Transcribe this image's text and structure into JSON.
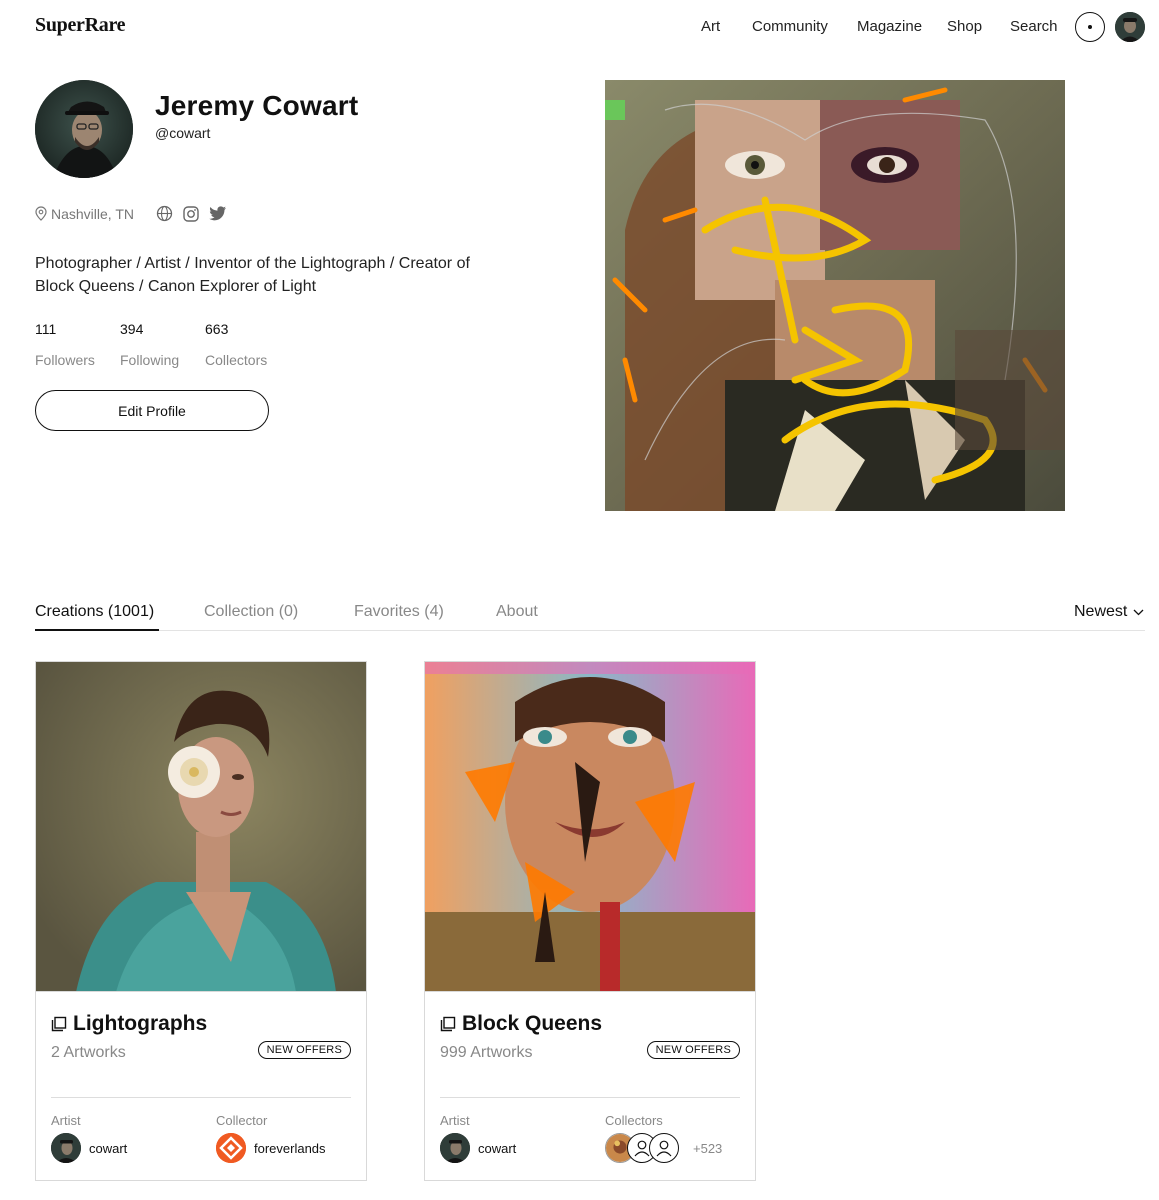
{
  "header": {
    "logo": "SuperRare",
    "nav": [
      "Art",
      "Community",
      "Magazine",
      "Shop",
      "Search"
    ]
  },
  "profile": {
    "name": "Jeremy Cowart",
    "handle": "@cowart",
    "location": "Nashville, TN",
    "bio": "Photographer / Artist / Inventor of the Lightograph / Creator of Block Queens / Canon Explorer of Light",
    "stats": [
      {
        "value": "111",
        "label": "Followers"
      },
      {
        "value": "394",
        "label": "Following"
      },
      {
        "value": "663",
        "label": "Collectors"
      }
    ],
    "edit_label": "Edit Profile"
  },
  "tabs": {
    "items": [
      "Creations (1001)",
      "Collection (0)",
      "Favorites (4)",
      "About"
    ],
    "sort": "Newest"
  },
  "cards": [
    {
      "title": "Lightographs",
      "count": "2 Artworks",
      "badge": "NEW OFFERS",
      "artist_label": "Artist",
      "artist": "cowart",
      "collector_label": "Collector",
      "collector": "foreverlands"
    },
    {
      "title": "Block Queens",
      "count": "999 Artworks",
      "badge": "NEW OFFERS",
      "artist_label": "Artist",
      "artist": "cowart",
      "collector_label": "Collectors",
      "collector_more": "+523"
    }
  ],
  "colors": {
    "text": "#111111",
    "muted": "#888888",
    "foreverlands_orange": "#f05a22"
  }
}
